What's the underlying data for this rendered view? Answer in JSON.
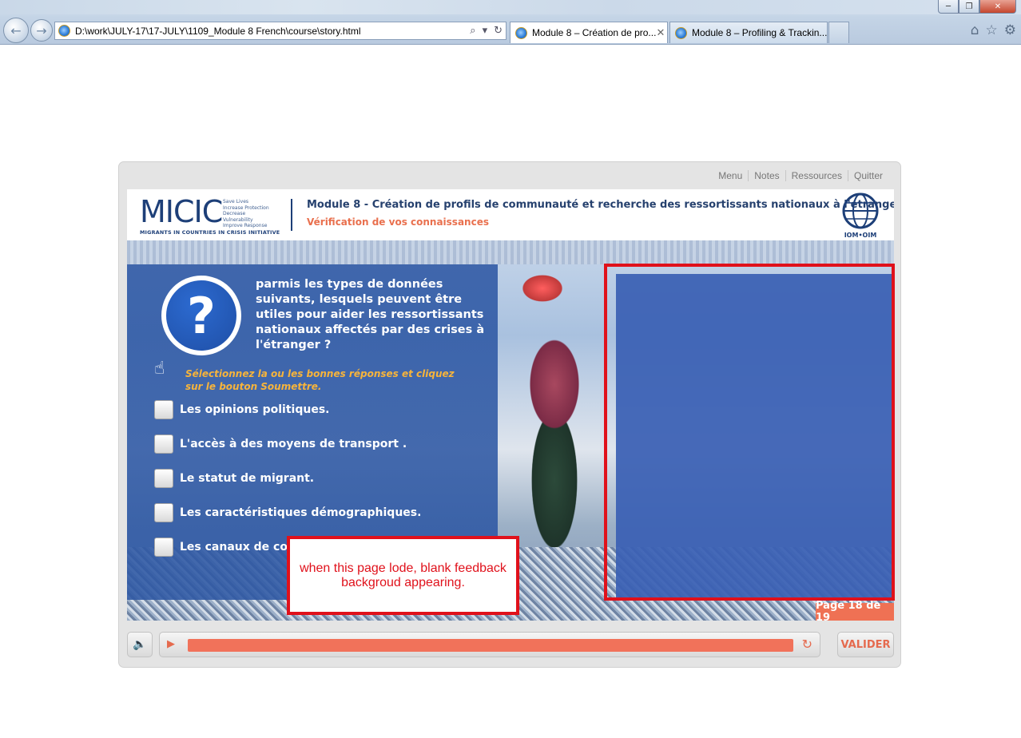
{
  "browser": {
    "address": "D:\\work\\JULY-17\\17-JULY\\1109_Module 8 French\\course\\story.html",
    "tabs": [
      {
        "label": "Module 8 – Création de pro...",
        "active": true
      },
      {
        "label": "Module 8 – Profiling & Trackin...",
        "active": false
      }
    ],
    "window_controls": {
      "minimize": "─",
      "restore": "❐",
      "close": "✕"
    },
    "tool_icons": [
      "home-icon",
      "star-icon",
      "gear-icon"
    ]
  },
  "player": {
    "top_links": [
      "Menu",
      "Notes",
      "Ressources",
      "Quitter"
    ],
    "header": {
      "logo_letters": "MICIC",
      "logo_tagline": [
        "Save Lives",
        "Increase Protection",
        "Decrease Vulnerability",
        "Improve Response"
      ],
      "logo_sub": "MIGRANTS IN COUNTRIES IN CRISIS INITIATIVE",
      "module_title": "Module 8 - Création de profils de communauté et recherche des ressortissants nationaux à l'étranger",
      "module_subtitle": "Vérification de vos connaissances",
      "iom_text": "IOM•OIM"
    },
    "question": {
      "text": "parmis les types de  données suivants, lesquels peuvent être utiles pour aider les ressortissants nationaux affectés par des crises à l'étranger ?",
      "instruction": "Sélectionnez la ou les bonnes réponses et cliquez sur le bouton Soumettre.",
      "options": [
        "Les opinions politiques.",
        "L'accès à des moyens de transport .",
        "Le statut de migrant.",
        "Les caractéristiques démographiques.",
        "Les canaux de communication."
      ]
    },
    "page_counter": "Page 18 de 19",
    "controls": {
      "submit_label": "VALIDER",
      "progress": 1.0
    },
    "colors": {
      "accent": "#f1725a",
      "panel": "#2e58a4",
      "annotation": "#e0111b"
    }
  },
  "annotation": {
    "note": "when this page lode, blank feedback backgroud appearing."
  }
}
